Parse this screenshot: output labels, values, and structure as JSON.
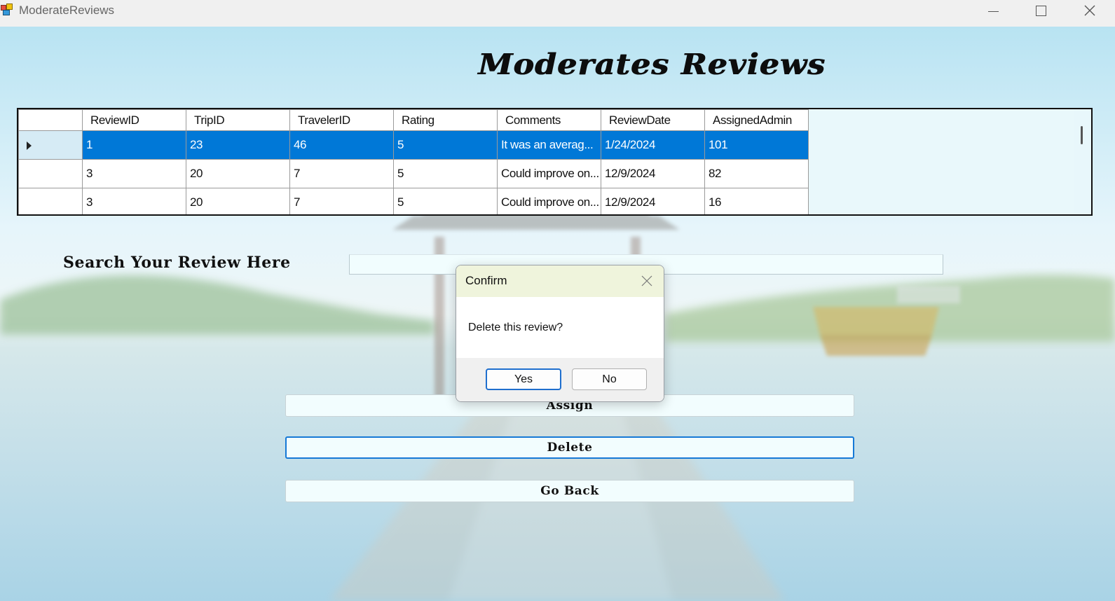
{
  "window": {
    "title": "ModerateReviews"
  },
  "form": {
    "title": "Moderates Reviews",
    "search_label": "Search Your Review Here",
    "search_value": ""
  },
  "grid": {
    "columns": [
      "ReviewID",
      "TripID",
      "TravelerID",
      "Rating",
      "Comments",
      "ReviewDate",
      "AssignedAdmin"
    ],
    "rows": [
      {
        "selected": true,
        "cells": [
          "1",
          "23",
          "46",
          "5",
          "It was an averag...",
          "1/24/2024",
          "101"
        ]
      },
      {
        "selected": false,
        "cells": [
          "3",
          "20",
          "7",
          "5",
          "Could improve on...",
          "12/9/2024",
          "82"
        ]
      },
      {
        "selected": false,
        "cells": [
          "3",
          "20",
          "7",
          "5",
          "Could improve on...",
          "12/9/2024",
          "16"
        ]
      }
    ]
  },
  "buttons": {
    "assign": "Assign",
    "delete": "Delete",
    "back": "Go Back"
  },
  "dialog": {
    "title": "Confirm",
    "message": "Delete this review?",
    "yes": "Yes",
    "no": "No"
  },
  "colors": {
    "selection": "#0078d7",
    "dialog_header": "#eff4dc",
    "focus_border": "#1679d6"
  }
}
